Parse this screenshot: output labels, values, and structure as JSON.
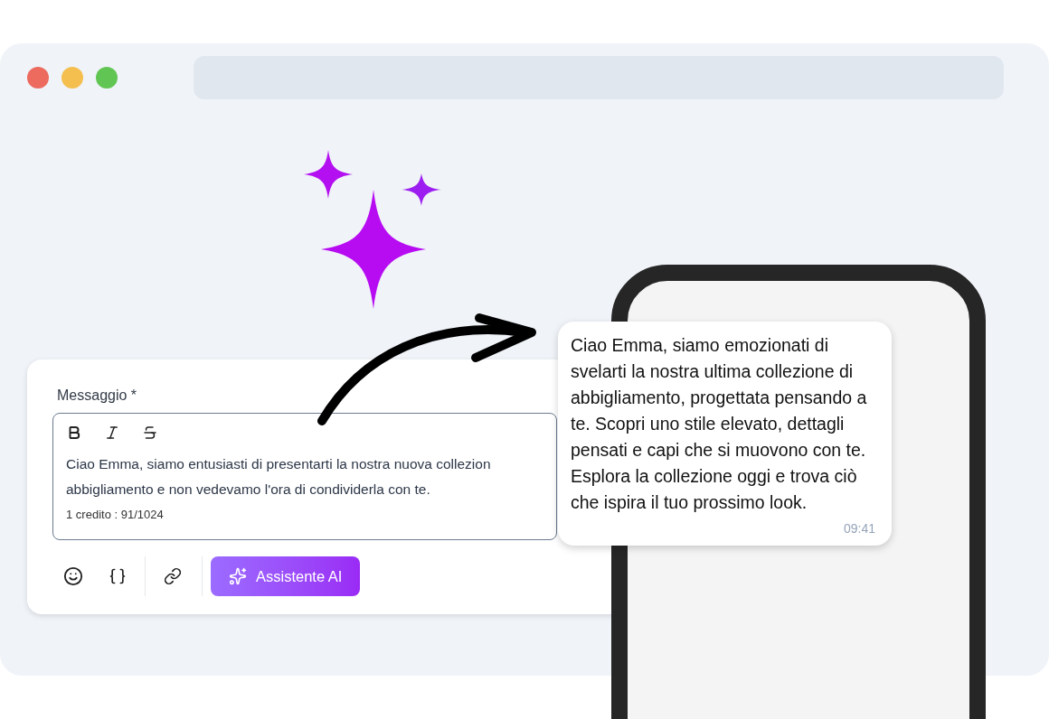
{
  "window": {
    "controls": [
      {
        "color": "#ec6a5e"
      },
      {
        "color": "#f4bf4f"
      },
      {
        "color": "#61c554"
      }
    ]
  },
  "editor": {
    "label": "Messaggio *",
    "text_lines": [
      "Ciao Emma, siamo entusiasti di presentarti la nostra nuova collezion",
      "abbigliamento e non vedevamo l'ora di condividerla con te."
    ],
    "counter": "1 credito : 91/1024",
    "ai_button": "Assistente AI"
  },
  "bubble": {
    "text": "Ciao Emma, siamo emozionati di svelarti la nostra ultima collezione di abbigliamento, progettata pensando a te. Scopri uno stile elevato, dettagli pensati e capi che si muovono con te. Esplora la collezione oggi e trova ciò che ispira il tuo prossimo look.",
    "time": "09:41"
  }
}
